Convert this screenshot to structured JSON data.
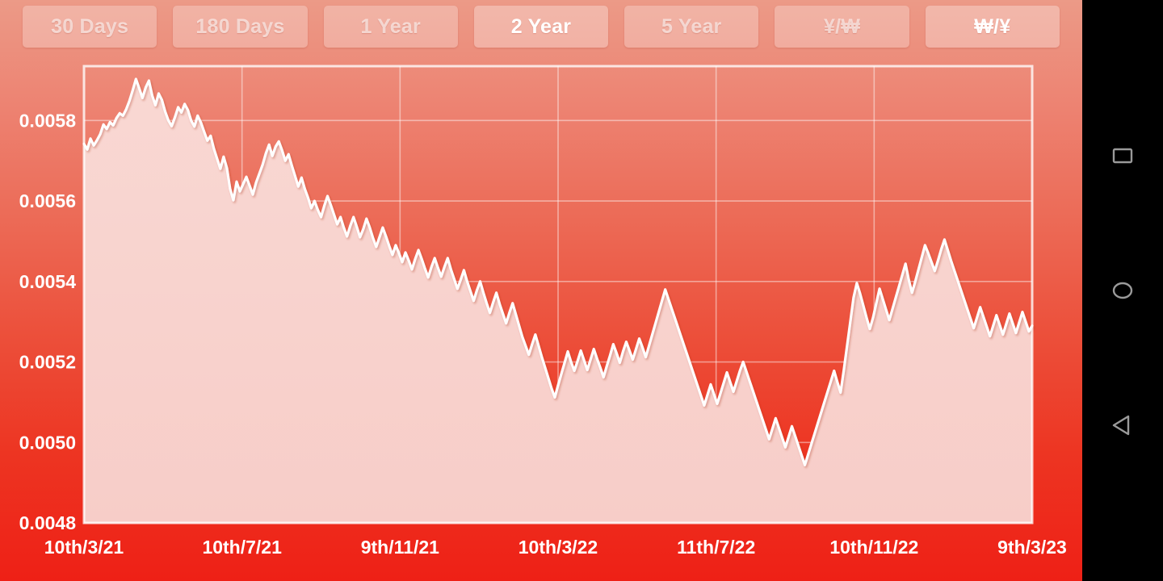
{
  "app": {
    "background_top": "#ec9a87",
    "background_bottom": "#ee2016"
  },
  "period_bar": {
    "buttons": [
      {
        "label": "30 Days",
        "active": false,
        "name": "period-button-30-days"
      },
      {
        "label": "180 Days",
        "active": false,
        "name": "period-button-180-days"
      },
      {
        "label": "1 Year",
        "active": false,
        "name": "period-button-1-year"
      },
      {
        "label": "2 Year",
        "active": true,
        "name": "period-button-2-year"
      },
      {
        "label": "5 Year",
        "active": false,
        "name": "period-button-5-year"
      },
      {
        "label": "¥/₩",
        "active": false,
        "name": "pair-button-jpy-krw"
      },
      {
        "label": "₩/¥",
        "active": true,
        "name": "pair-button-krw-jpy"
      }
    ]
  },
  "navbar": {
    "keys": [
      {
        "name": "recent-apps-icon",
        "glyph": "square"
      },
      {
        "name": "home-icon",
        "glyph": "circle"
      },
      {
        "name": "back-icon",
        "glyph": "triangle-left"
      }
    ],
    "icon_color": "#9a9a9a",
    "background": "#000000"
  },
  "chart_data": {
    "type": "area",
    "title": "",
    "xlabel": "",
    "ylabel": "",
    "line_color": "#ffffff",
    "fill_color": "#f7d2cd",
    "grid": true,
    "legend": "none",
    "ylim": [
      0.0048,
      0.005935
    ],
    "yticks": [
      0.0058,
      0.0056,
      0.0054,
      0.0052,
      0.005,
      0.0048
    ],
    "ytick_labels": [
      "0.0058",
      "0.0056",
      "0.0054",
      "0.0052",
      "0.0050",
      "0.0048"
    ],
    "xticks": [
      0,
      1,
      2,
      3,
      4,
      5,
      6
    ],
    "xtick_labels": [
      "10th/3/21",
      "10th/7/21",
      "9th/11/21",
      "10th/3/22",
      "11th/7/22",
      "10th/11/22",
      "9th/3/23"
    ],
    "series": [
      {
        "name": "KRW/JPY",
        "values": [
          0.005742,
          0.005728,
          0.005755,
          0.005738,
          0.005751,
          0.005766,
          0.00579,
          0.005779,
          0.005796,
          0.005788,
          0.005806,
          0.005818,
          0.005812,
          0.005828,
          0.005849,
          0.005875,
          0.005903,
          0.00588,
          0.005856,
          0.005882,
          0.005899,
          0.005862,
          0.005838,
          0.005867,
          0.005851,
          0.005822,
          0.0058,
          0.005786,
          0.005808,
          0.005833,
          0.00582,
          0.005841,
          0.005826,
          0.0058,
          0.005785,
          0.005812,
          0.005795,
          0.005772,
          0.00575,
          0.005762,
          0.00573,
          0.005705,
          0.00568,
          0.00571,
          0.005682,
          0.00563,
          0.005602,
          0.005648,
          0.005624,
          0.005642,
          0.00566,
          0.005638,
          0.005616,
          0.005646,
          0.005668,
          0.00569,
          0.005718,
          0.00574,
          0.005712,
          0.005735,
          0.005748,
          0.005726,
          0.0057,
          0.005716,
          0.005688,
          0.005662,
          0.005636,
          0.005658,
          0.00563,
          0.005608,
          0.005582,
          0.0056,
          0.005578,
          0.00556,
          0.005588,
          0.005612,
          0.00559,
          0.005566,
          0.005542,
          0.00556,
          0.005534,
          0.005512,
          0.005538,
          0.00556,
          0.005536,
          0.00551,
          0.00553,
          0.005556,
          0.005534,
          0.005508,
          0.005486,
          0.00551,
          0.005534,
          0.005512,
          0.005488,
          0.005466,
          0.00549,
          0.00547,
          0.005448,
          0.005472,
          0.005452,
          0.00543,
          0.005456,
          0.005478,
          0.005456,
          0.005432,
          0.00541,
          0.005436,
          0.005458,
          0.005434,
          0.005412,
          0.005436,
          0.005458,
          0.00543,
          0.005406,
          0.005382,
          0.005404,
          0.005428,
          0.0054,
          0.005376,
          0.005352,
          0.005378,
          0.0054,
          0.005372,
          0.005346,
          0.005322,
          0.005348,
          0.005372,
          0.005344,
          0.00532,
          0.005296,
          0.005322,
          0.005346,
          0.005318,
          0.00529,
          0.005262,
          0.00524,
          0.005218,
          0.005244,
          0.005268,
          0.00524,
          0.005212,
          0.005186,
          0.00516,
          0.005134,
          0.005112,
          0.005142,
          0.00517,
          0.005198,
          0.005226,
          0.0052,
          0.005178,
          0.005202,
          0.005228,
          0.005204,
          0.00518,
          0.005206,
          0.005232,
          0.005208,
          0.005186,
          0.005162,
          0.00519,
          0.005216,
          0.005244,
          0.005222,
          0.005198,
          0.005226,
          0.00525,
          0.005228,
          0.005206,
          0.005232,
          0.005258,
          0.005236,
          0.005212,
          0.00524,
          0.005268,
          0.005296,
          0.005324,
          0.005352,
          0.00538,
          0.005356,
          0.005332,
          0.005308,
          0.005284,
          0.00526,
          0.005236,
          0.005212,
          0.005188,
          0.005164,
          0.00514,
          0.005116,
          0.005092,
          0.005118,
          0.005144,
          0.00512,
          0.005096,
          0.005122,
          0.005148,
          0.005174,
          0.00515,
          0.005126,
          0.005152,
          0.005178,
          0.0052,
          0.005176,
          0.005152,
          0.005128,
          0.005104,
          0.00508,
          0.005056,
          0.005032,
          0.005008,
          0.005034,
          0.00506,
          0.005036,
          0.005012,
          0.004988,
          0.005014,
          0.00504,
          0.005016,
          0.004992,
          0.004968,
          0.004944,
          0.00497,
          0.004996,
          0.005022,
          0.005048,
          0.005074,
          0.0051,
          0.005126,
          0.005152,
          0.005178,
          0.00515,
          0.005124,
          0.00518,
          0.00524,
          0.0053,
          0.00536,
          0.005396,
          0.00537,
          0.00534,
          0.00531,
          0.005282,
          0.00531,
          0.005346,
          0.005382,
          0.005356,
          0.00533,
          0.005304,
          0.005332,
          0.00536,
          0.005388,
          0.005416,
          0.005444,
          0.005404,
          0.005372,
          0.0054,
          0.00543,
          0.00546,
          0.00549,
          0.00547,
          0.005448,
          0.005426,
          0.005452,
          0.00548,
          0.005504,
          0.005478,
          0.005452,
          0.005428,
          0.005404,
          0.00538,
          0.005356,
          0.005332,
          0.005308,
          0.005284,
          0.00531,
          0.005336,
          0.005312,
          0.005288,
          0.005264,
          0.00529,
          0.005316,
          0.005292,
          0.005268,
          0.005294,
          0.00532,
          0.005296,
          0.005272,
          0.005298,
          0.005324,
          0.0053,
          0.005276,
          0.00529
        ]
      }
    ],
    "peak": {
      "value": 0.005903,
      "label": "0.005903"
    },
    "trough": {
      "value": 0.004944,
      "label": "0.004944"
    },
    "last_value": 0.00529
  }
}
